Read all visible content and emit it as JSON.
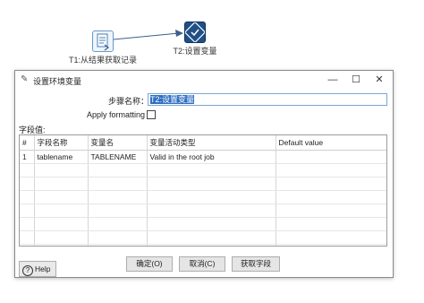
{
  "canvas": {
    "step1": {
      "label": "T1:从结果获取记录",
      "icon": "get-rows-from-result-icon"
    },
    "step2": {
      "label": "T2:设置变量",
      "icon": "set-variables-icon"
    }
  },
  "dialog": {
    "title": "设置环境变量",
    "title_icon": "variables-icon",
    "window_controls": {
      "minimize": "—",
      "maximize": "☐",
      "close": "✕"
    },
    "step_name_label": "步骤名称：",
    "step_name_value": "T2:设置变量",
    "apply_formatting_label": "Apply formatting",
    "apply_formatting_checked": false,
    "fields_label": "字段值:",
    "table": {
      "columns": [
        "#",
        "字段名称",
        "变量名",
        "变量活动类型",
        "Default value"
      ],
      "rows": [
        [
          "1",
          "tablename",
          "TABLENAME",
          "Valid in the root job",
          ""
        ]
      ]
    },
    "buttons": {
      "ok": "确定(O)",
      "cancel": "取消(C)",
      "get_fields": "获取字段",
      "help": "Help"
    }
  },
  "colors": {
    "accent": "#2f6fc3",
    "step2_bg": "#1f4f86",
    "hop": "#3b5f8a"
  }
}
